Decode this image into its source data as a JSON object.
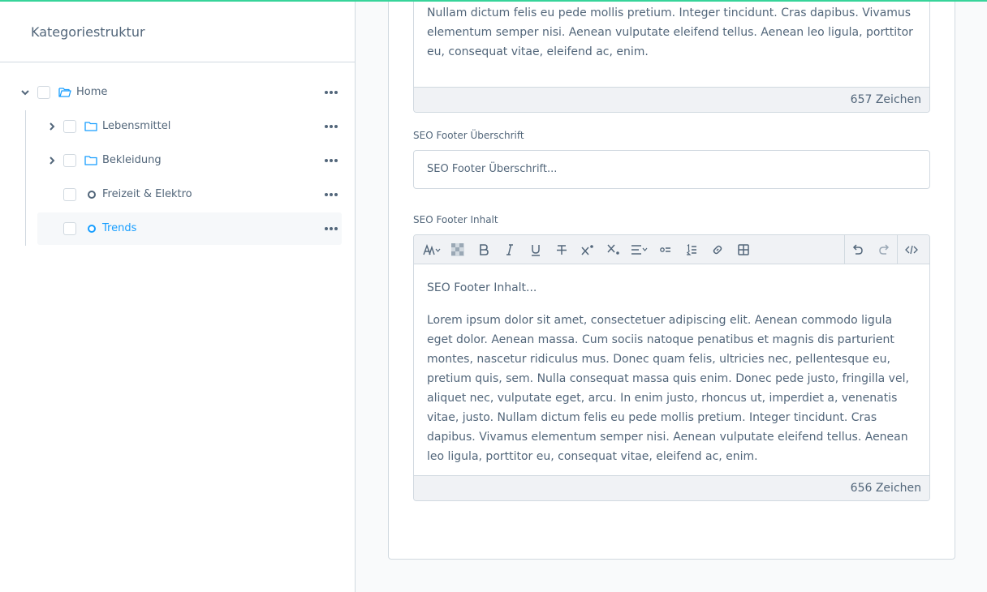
{
  "sidebar": {
    "title": "Kategoriestruktur",
    "tree": [
      {
        "label": "Home",
        "icon": "folder-open-icon",
        "expanded": true
      },
      {
        "label": "Lebensmittel",
        "icon": "folder-icon",
        "expanded": false
      },
      {
        "label": "Bekleidung",
        "icon": "folder-icon",
        "expanded": false
      },
      {
        "label": "Freizeit & Elektro",
        "icon": "circle-icon"
      },
      {
        "label": "Trends",
        "icon": "circle-icon",
        "active": true
      }
    ]
  },
  "editor_top": {
    "text": "vulputate eget, arcu. In enim justo, rhoncus ut, imperdiet a, venenatis vitae, justo. Nullam dictum felis eu pede mollis pretium. Integer tincidunt. Cras dapibus. Vivamus elementum semper nisi. Aenean vulputate eleifend tellus. Aenean leo ligula, porttitor eu, consequat vitae, eleifend ac, enim.",
    "char_count": "657 Zeichen"
  },
  "seo_footer_heading": {
    "label": "SEO Footer Überschrift",
    "placeholder": "SEO Footer Überschrift..."
  },
  "seo_footer_content": {
    "label": "SEO Footer Inhalt",
    "first_line": "SEO Footer Inhalt...",
    "text": "Lorem ipsum dolor sit amet, consectetuer adipiscing elit. Aenean commodo ligula eget dolor. Aenean massa. Cum sociis natoque penatibus et magnis dis parturient montes, nascetur ridiculus mus. Donec quam felis, ultricies nec, pellentesque eu, pretium quis, sem. Nulla consequat massa quis enim. Donec pede justo, fringilla vel, aliquet nec, vulputate eget, arcu. In enim justo, rhoncus ut, imperdiet a, venenatis vitae, justo. Nullam dictum felis eu pede mollis pretium. Integer tincidunt. Cras dapibus. Vivamus elementum semper nisi. Aenean vulputate eleifend tellus. Aenean leo ligula, porttitor eu, consequat vitae, eleifend ac, enim.",
    "char_count": "656 Zeichen",
    "toolbar": [
      "text-style-icon",
      "background-color-icon",
      "bold-icon",
      "italic-icon",
      "underline-icon",
      "strikethrough-icon",
      "superscript-icon",
      "subscript-icon",
      "align-icon",
      "unordered-list-icon",
      "ordered-list-icon",
      "link-icon",
      "table-icon",
      "undo-icon",
      "redo-icon",
      "code-view-icon"
    ]
  },
  "colors": {
    "accent": "#189eff",
    "top_line": "#37d49a",
    "text": "#52667a",
    "border": "#d1d9e0"
  }
}
